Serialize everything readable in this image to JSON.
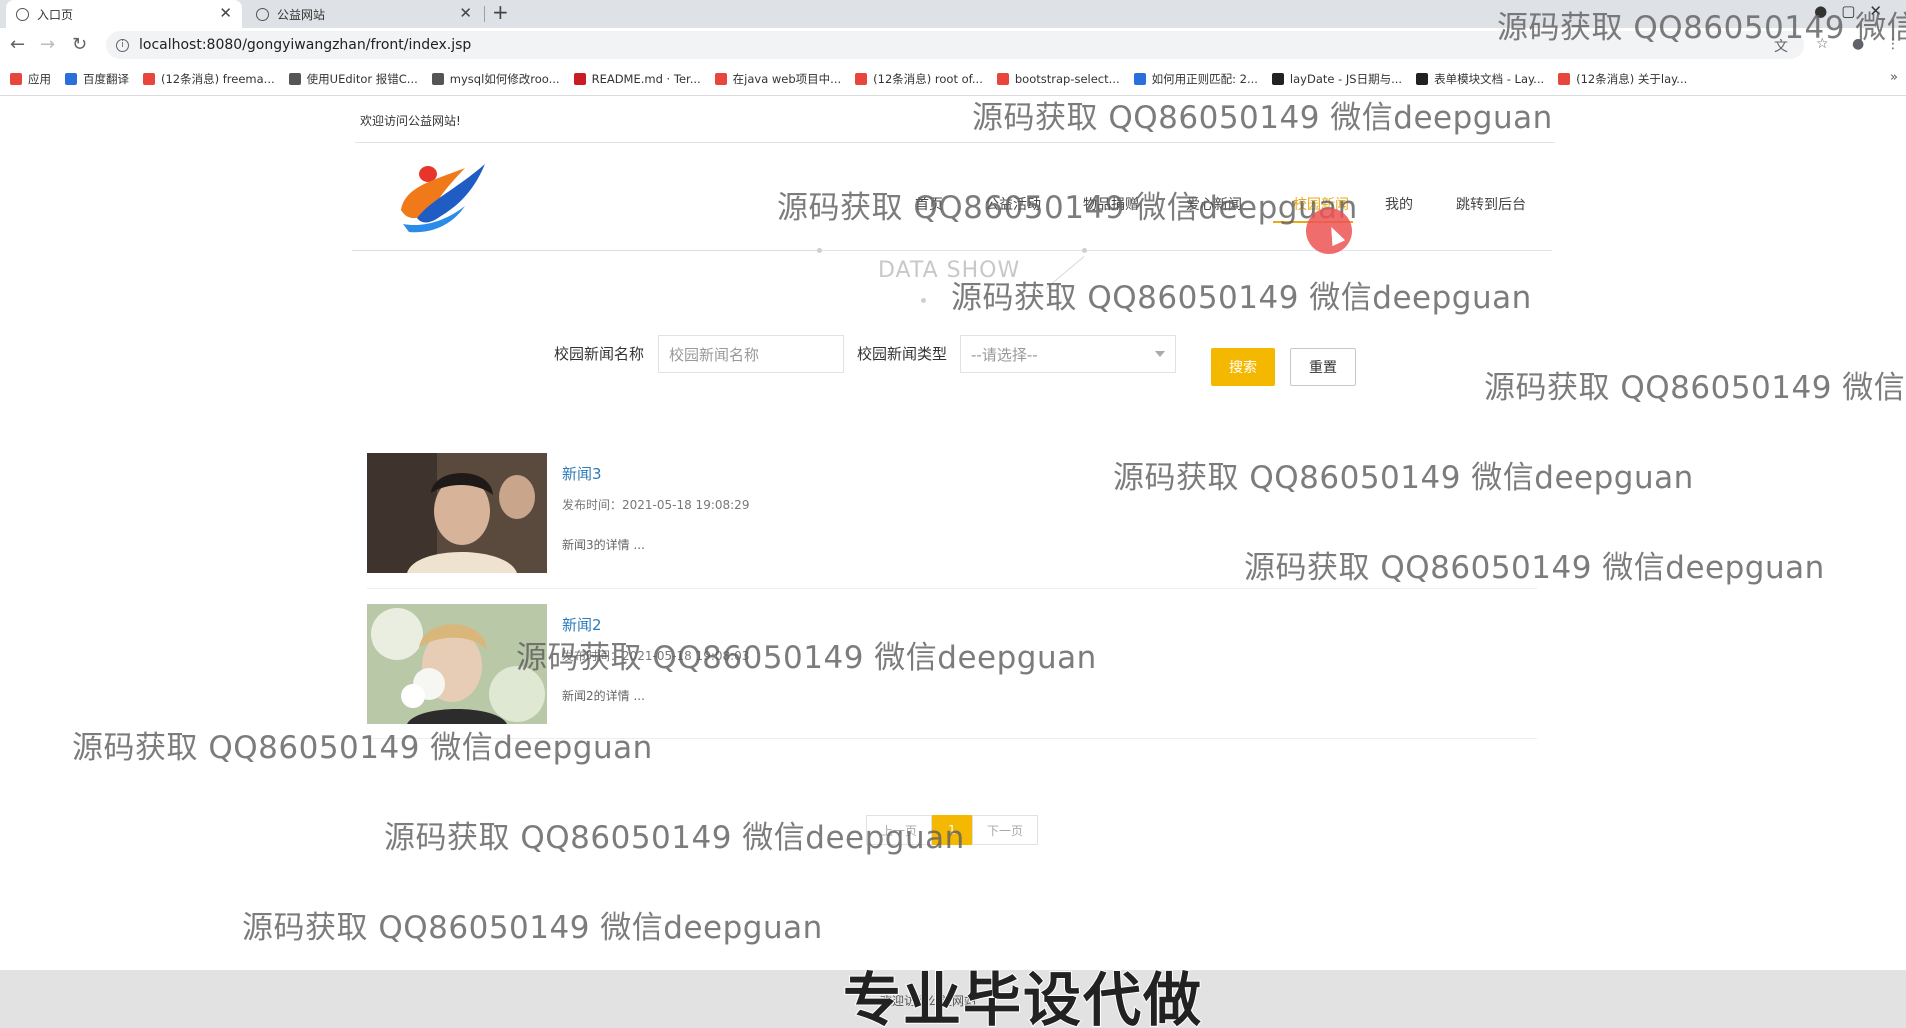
{
  "browser": {
    "tabs": [
      {
        "label": "入口页",
        "active": true
      },
      {
        "label": "公益网站",
        "active": false
      }
    ],
    "url": "localhost:8080/gongyiwangzhan/front/index.jsp",
    "bookmarks": [
      {
        "label": "应用",
        "icon": "apps-grid-icon",
        "color": "#e8453c"
      },
      {
        "label": "百度翻译",
        "icon": "translate-icon",
        "color": "#2a6fdb"
      },
      {
        "label": "(12条消息) freema...",
        "icon": "csdn-icon",
        "color": "#e8453c"
      },
      {
        "label": "使用UEditor 报错C...",
        "icon": "link-icon",
        "color": "#555555"
      },
      {
        "label": "mysql如何修改roo...",
        "icon": "link-icon",
        "color": "#555555"
      },
      {
        "label": "README.md · Ter...",
        "icon": "gitee-icon",
        "color": "#c71d23"
      },
      {
        "label": "在java web项目中...",
        "icon": "csdn-icon",
        "color": "#e8453c"
      },
      {
        "label": "(12条消息) root of...",
        "icon": "csdn-icon",
        "color": "#e8453c"
      },
      {
        "label": "bootstrap-select...",
        "icon": "page-icon",
        "color": "#e8453c"
      },
      {
        "label": "如何用正则匹配: 2...",
        "icon": "baidu-icon",
        "color": "#2a6fdb"
      },
      {
        "label": "layDate - JS日期与...",
        "icon": "layui-icon",
        "color": "#222222"
      },
      {
        "label": "表单模块文档 - Lay...",
        "icon": "layui-icon",
        "color": "#222222"
      },
      {
        "label": "(12条消息) 关于lay...",
        "icon": "csdn-icon",
        "color": "#e8453c"
      }
    ]
  },
  "page": {
    "welcome": "欢迎访问公益网站!",
    "nav": [
      {
        "label": "首页",
        "active": false
      },
      {
        "label": "公益活动",
        "active": false
      },
      {
        "label": "物品捐赠",
        "active": false
      },
      {
        "label": "爱心新闻",
        "active": false
      },
      {
        "label": "校园新闻",
        "active": true
      },
      {
        "label": "我的",
        "active": false
      },
      {
        "label": "跳转到后台",
        "active": false
      }
    ],
    "section_banner": "DATA SHOW",
    "search": {
      "name_label": "校园新闻名称",
      "name_placeholder": "校园新闻名称",
      "type_label": "校园新闻类型",
      "type_selected": "--请选择--",
      "search_button": "搜索",
      "reset_button": "重置"
    },
    "news": [
      {
        "title": "新闻3",
        "time": "发布时间：2021-05-18 19:08:29",
        "desc": "新闻3的详情 ..."
      },
      {
        "title": "新闻2",
        "time": "发布时间：2021-05-18 19:08:03",
        "desc": "新闻2的详情 ..."
      }
    ],
    "pager": {
      "prev": "上一页",
      "current": "1",
      "next": "下一页"
    },
    "footer": "欢迎访问公益网站"
  },
  "overlay": {
    "watermark": "源码获取 QQ86050149 微信deepguan",
    "caption": "专业毕设代做"
  },
  "colors": {
    "accent": "#f5b800",
    "nav_active": "#e8a817",
    "link": "#2b7bb9"
  }
}
